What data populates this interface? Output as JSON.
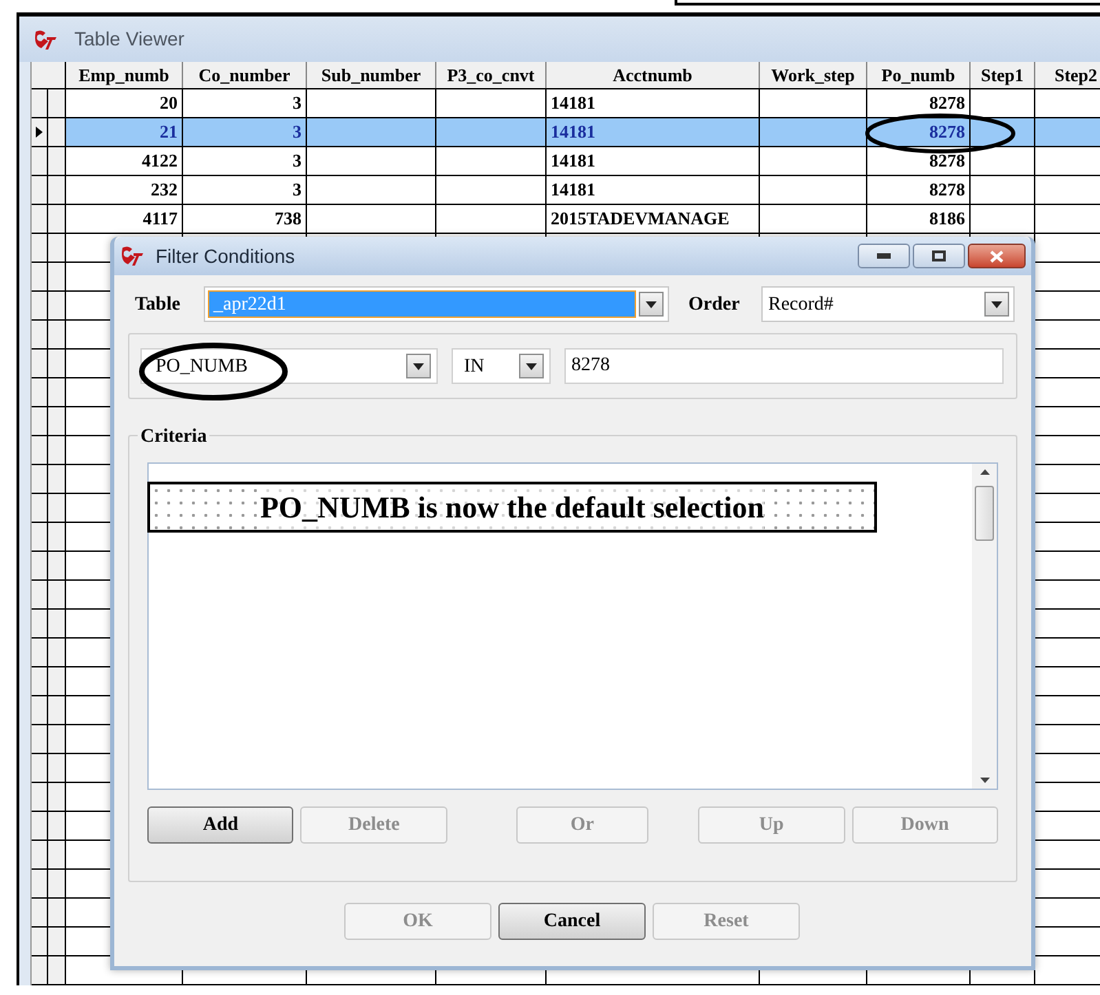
{
  "table_viewer": {
    "title": "Table Viewer",
    "columns": [
      "Emp_numb",
      "Co_number",
      "Sub_number",
      "P3_co_cnvt",
      "Acctnumb",
      "Work_step",
      "Po_numb",
      "Step1",
      "Step2"
    ],
    "rows": [
      {
        "selected": false,
        "cells": [
          "20",
          "3",
          "",
          "",
          "14181",
          "",
          "8278",
          "",
          ""
        ]
      },
      {
        "selected": true,
        "cells": [
          "21",
          "3",
          "",
          "",
          "14181",
          "",
          "8278",
          "",
          ""
        ]
      },
      {
        "selected": false,
        "cells": [
          "4122",
          "3",
          "",
          "",
          "14181",
          "",
          "8278",
          "",
          ""
        ]
      },
      {
        "selected": false,
        "cells": [
          "232",
          "3",
          "",
          "",
          "14181",
          "",
          "8278",
          "",
          ""
        ]
      },
      {
        "selected": false,
        "cells": [
          "4117",
          "738",
          "",
          "",
          "2015TADEVMANAGE",
          "",
          "8186",
          "",
          ""
        ]
      }
    ]
  },
  "dialog": {
    "title": "Filter Conditions",
    "table_label": "Table",
    "table_value": "_apr22d1",
    "order_label": "Order",
    "order_value": "Record#",
    "condition": {
      "field": "PO_NUMB",
      "operator": "IN",
      "value": "8278"
    },
    "criteria_label": "Criteria",
    "criteria_buttons": [
      {
        "label": "Add",
        "disabled": false
      },
      {
        "label": "Delete",
        "disabled": true
      },
      {
        "label": "Or",
        "disabled": true
      },
      {
        "label": "Up",
        "disabled": true
      },
      {
        "label": "Down",
        "disabled": true
      }
    ],
    "footer_buttons": [
      {
        "label": "OK",
        "disabled": true
      },
      {
        "label": "Cancel",
        "disabled": false
      },
      {
        "label": "Reset",
        "disabled": true
      }
    ]
  },
  "callout": {
    "text": "PO_NUMB is now the default selection"
  }
}
